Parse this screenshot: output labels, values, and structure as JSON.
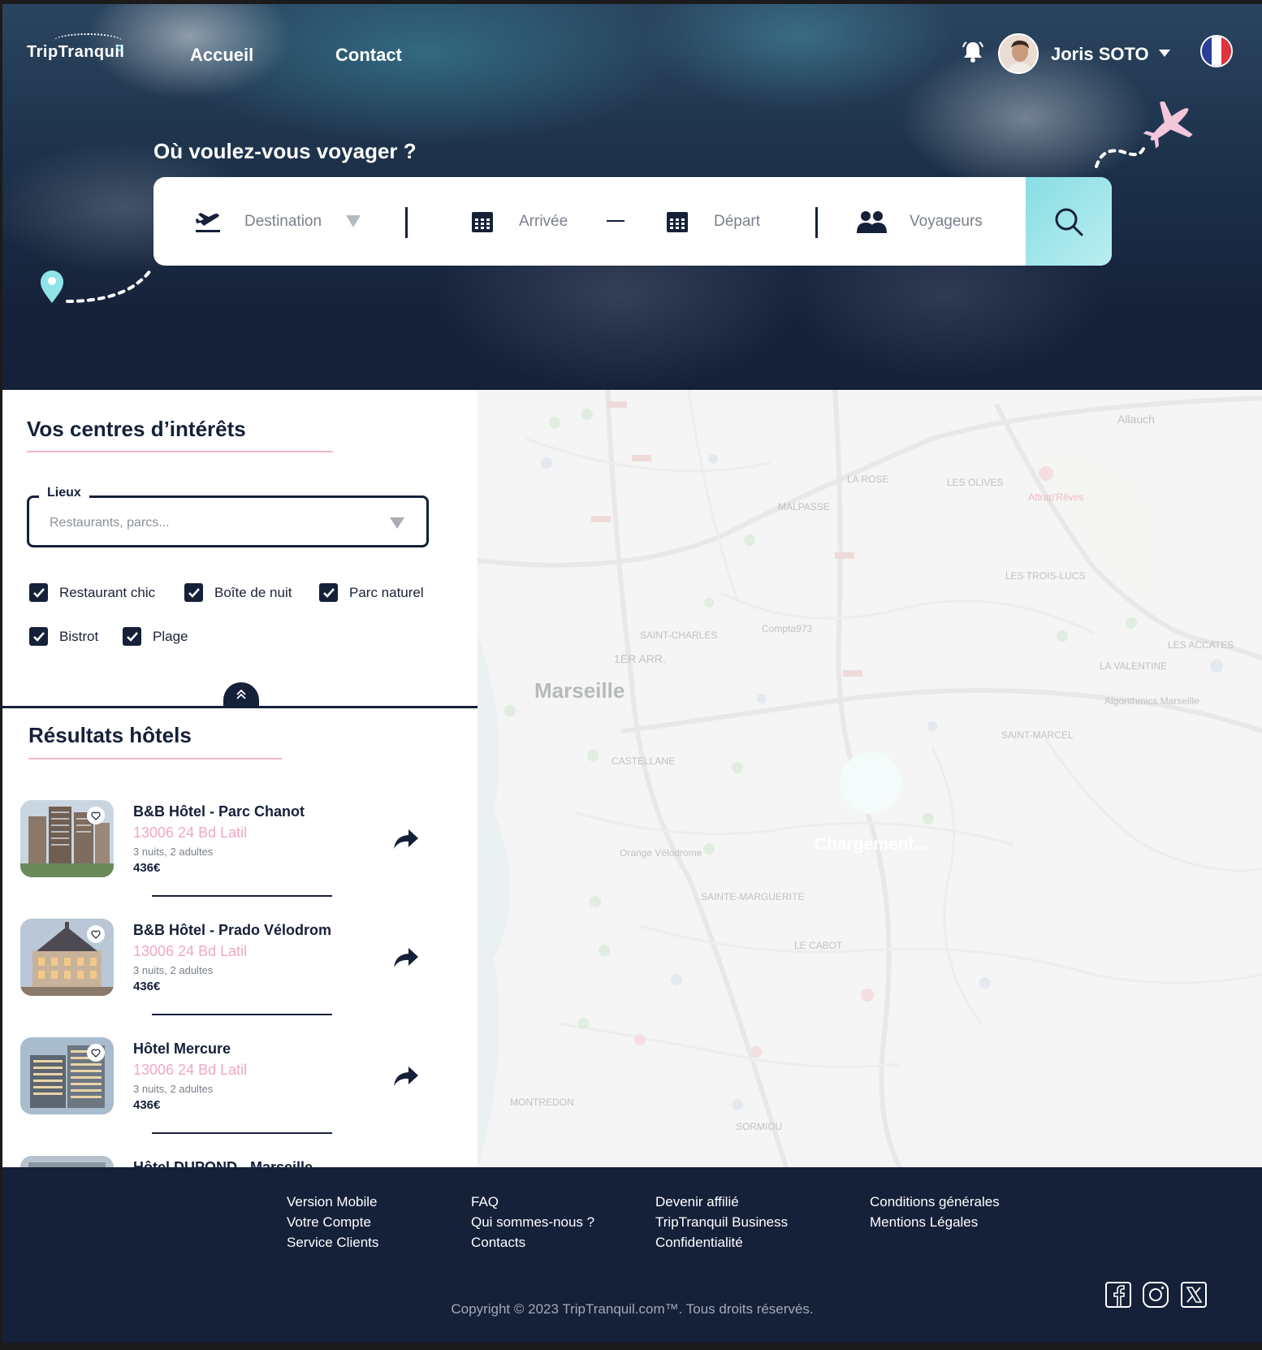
{
  "header": {
    "logo": "TripTranquil",
    "nav": [
      "Accueil",
      "Contact"
    ],
    "user_name": "Joris SOTO"
  },
  "hero": {
    "title": "Où voulez-vous voyager ?",
    "search": {
      "destination": "Destination",
      "arrival": "Arrivée",
      "departure": "Départ",
      "travelers": "Voyageurs"
    }
  },
  "interests": {
    "title": "Vos centres d’intérêts",
    "places_label": "Lieux",
    "places_placeholder": "Restaurants, parcs...",
    "checkboxes": [
      "Restaurant chic",
      "Boîte de nuit",
      "Parc naturel",
      "Bistrot",
      "Plage"
    ]
  },
  "results": {
    "title": "Résultats hôtels",
    "hotels": [
      {
        "name": "B&B Hôtel - Parc Chanot",
        "address": "13006 24 Bd Latil",
        "stay": "3 nuits, 2 adultes",
        "price": "436€"
      },
      {
        "name": "B&B Hôtel - Prado Vélodrom",
        "address": "13006 24 Bd Latil",
        "stay": "3 nuits, 2 adultes",
        "price": "436€"
      },
      {
        "name": "Hôtel Mercure",
        "address": "13006 24 Bd Latil",
        "stay": "3 nuits, 2 adultes",
        "price": "436€"
      },
      {
        "name": "Hôtel DUPOND - Marseille",
        "address": "",
        "stay": "",
        "price": ""
      }
    ]
  },
  "map": {
    "city": "Marseille",
    "loading": "Chargement...",
    "labels": [
      "Allauch",
      "LES OLIVES",
      "MALPASSE",
      "LA ROSE",
      "LES TROIS-LUCS",
      "1ER ARR.",
      "SAINT-CHARLES",
      "CASTELLANE",
      "SAINTE-MARGUERITE",
      "LE CABOT",
      "SAINT-MARCEL",
      "LA VALENTINE",
      "LES ACCATES",
      "MONTREDON",
      "SORMIOU",
      "Attrap'Rêves",
      "Compta973",
      "Orange Vélodrome",
      "Algorithmics Marseille"
    ]
  },
  "footer": {
    "col1": [
      "Version Mobile",
      "Votre Compte",
      "Service Clients"
    ],
    "col2": [
      "FAQ",
      "Qui sommes-nous ?",
      "Contacts"
    ],
    "col3": [
      "Devenir affilié",
      "TripTranquil Business",
      "Confidentialité"
    ],
    "col4": [
      "Conditions générales",
      "Mentions Légales"
    ],
    "copyright": "Copyright © 2023 TripTranquil.com™. Tous droits réservés."
  },
  "colors": {
    "navy": "#152039",
    "accent_pink": "#f0a7c7",
    "accent_cyan": "#88dde4"
  }
}
